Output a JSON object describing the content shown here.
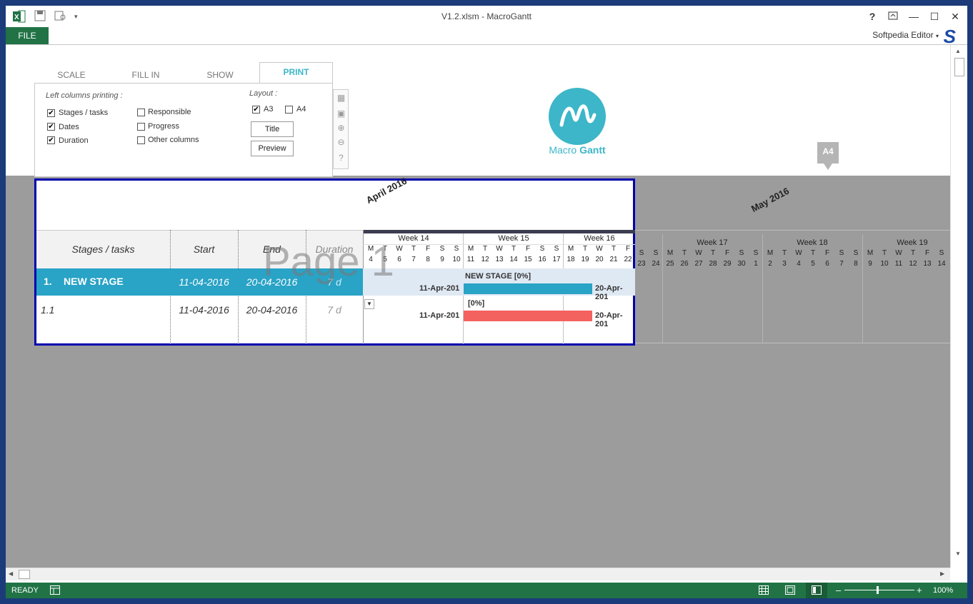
{
  "window": {
    "title": "V1.2.xlsm - MacroGantt",
    "file_tab": "FILE",
    "user": "Softpedia Editor",
    "help": "?",
    "controls": [
      "❐",
      "—",
      "☐",
      "✕"
    ]
  },
  "panel": {
    "tabs": [
      "SCALE",
      "FILL IN",
      "SHOW",
      "PRINT"
    ],
    "left_columns_label": "Left columns printing :",
    "layout_label": "Layout :",
    "checkboxes_left": [
      {
        "label": "Stages / tasks",
        "checked": true
      },
      {
        "label": "Dates",
        "checked": true
      },
      {
        "label": "Duration",
        "checked": true
      }
    ],
    "checkboxes_right": [
      {
        "label": "Responsible",
        "checked": false
      },
      {
        "label": "Progress",
        "checked": false
      },
      {
        "label": "Other columns",
        "checked": false
      }
    ],
    "layout_a3": "A3",
    "layout_a4": "A4",
    "title_button": "Title",
    "preview_button": "Preview"
  },
  "logo": {
    "brand_plain": "Macro",
    "brand_bold": "Gantt"
  },
  "a4_marker": "A4",
  "gantt": {
    "months": [
      "April 2016",
      "May 2016"
    ],
    "headers": {
      "stages": "Stages / tasks",
      "start": "Start",
      "end": "End",
      "duration": "Duration"
    },
    "weeks": [
      "Week  14",
      "Week  15",
      "Week  16",
      "Week  17",
      "Week  18",
      "Week  19"
    ],
    "day_letters": [
      "M",
      "T",
      "W",
      "T",
      "F",
      "S",
      "S",
      "M",
      "T",
      "W",
      "T",
      "F",
      "S",
      "S",
      "M",
      "T",
      "W",
      "T",
      "F",
      "S",
      "S",
      "M",
      "T",
      "W",
      "T",
      "F",
      "S",
      "S",
      "M",
      "T",
      "W",
      "T",
      "F",
      "S",
      "S",
      "M",
      "T",
      "W",
      "T",
      "F",
      "S"
    ],
    "day_numbers": [
      "4",
      "5",
      "6",
      "7",
      "8",
      "9",
      "10",
      "11",
      "12",
      "13",
      "14",
      "15",
      "16",
      "17",
      "18",
      "19",
      "20",
      "21",
      "22",
      "23",
      "24",
      "25",
      "26",
      "27",
      "28",
      "29",
      "30",
      "1",
      "2",
      "3",
      "4",
      "5",
      "6",
      "7",
      "8",
      "9",
      "10",
      "11",
      "12",
      "13",
      "14"
    ],
    "rows": [
      {
        "num": "1.",
        "name": "NEW STAGE",
        "start": "11-04-2016",
        "end": "20-04-2016",
        "duration": "7 d",
        "bar_label": "NEW STAGE [0%]",
        "bar_start": "11-Apr-201",
        "bar_end": "20-Apr-201"
      },
      {
        "num": "1.1",
        "name": "",
        "start": "11-04-2016",
        "end": "20-04-2016",
        "duration": "7 d",
        "bar_label": "[0%]",
        "bar_start": "11-Apr-201",
        "bar_end": "20-Apr-201"
      }
    ],
    "watermark": "Page 1"
  },
  "status": {
    "ready": "READY",
    "zoom": "100%"
  },
  "colors": {
    "excel_green": "#217346",
    "accent": "#3cb6c8",
    "stage_bar": "#29a3c6",
    "task_bar": "#f4625f",
    "page_border": "#0000b0"
  }
}
